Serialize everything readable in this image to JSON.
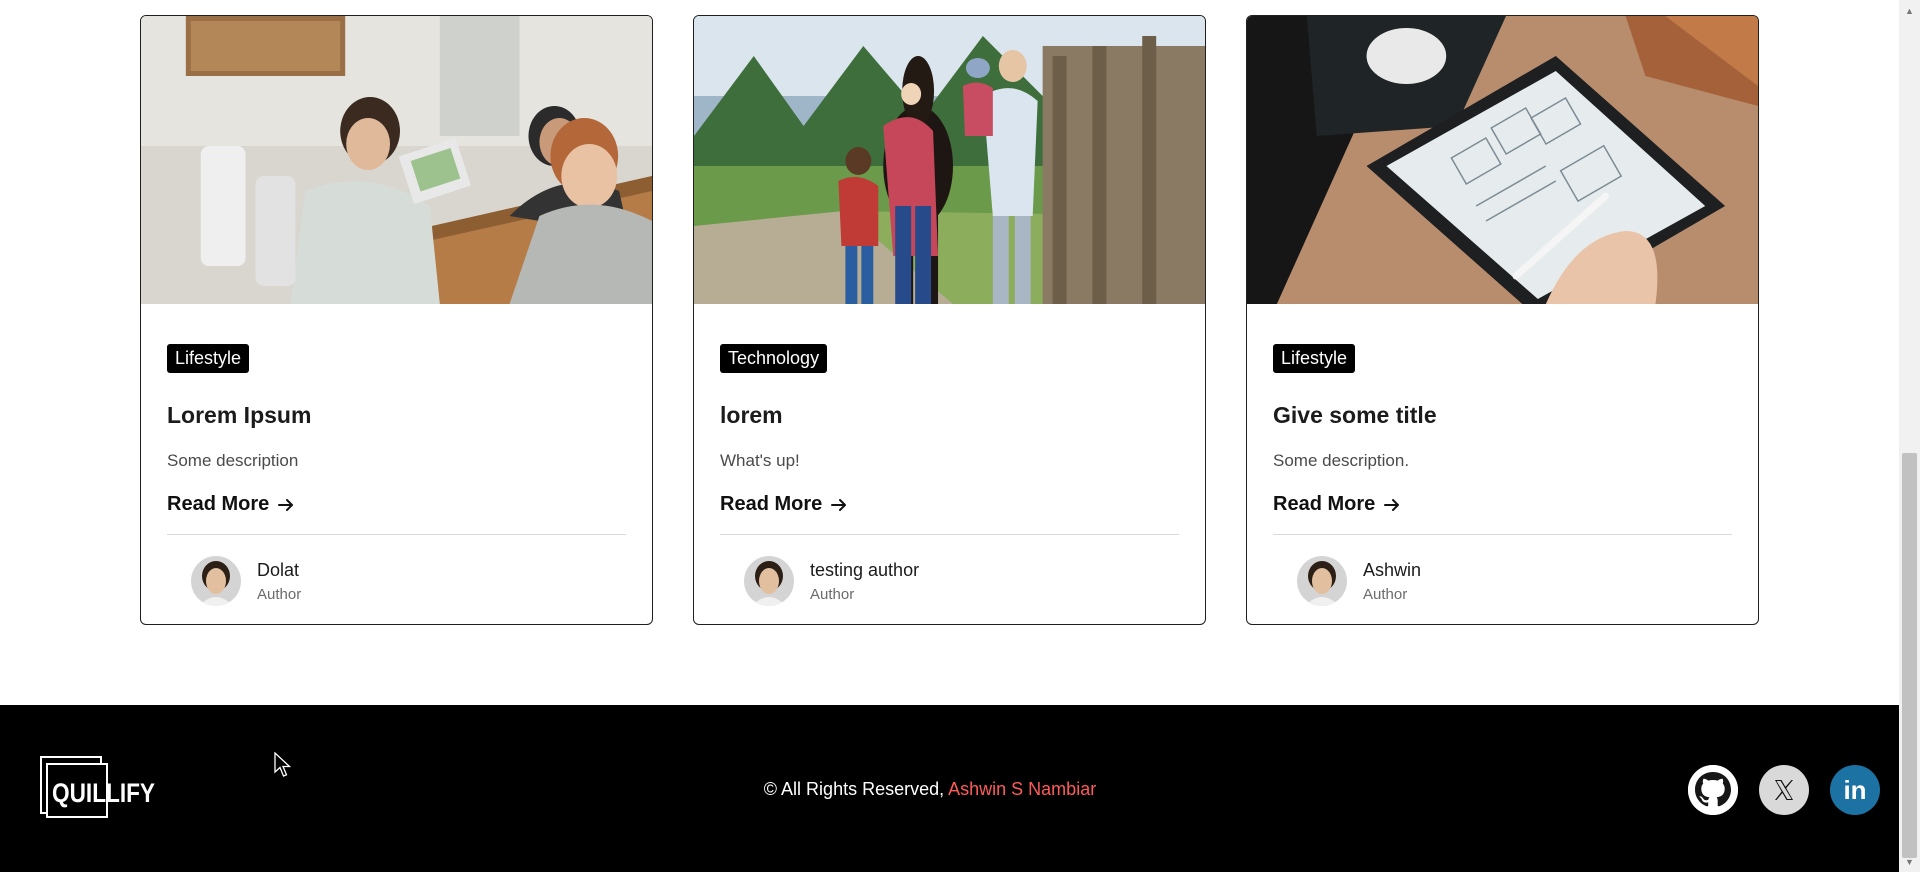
{
  "cards": [
    {
      "category": "Lifestyle",
      "title": "Lorem Ipsum",
      "description": "Some description",
      "read_more": "Read More",
      "author_name": "Dolat",
      "author_role": "Author"
    },
    {
      "category": "Technology",
      "title": "lorem",
      "description": "What's up!",
      "read_more": "Read More",
      "author_name": "testing author",
      "author_role": "Author"
    },
    {
      "category": "Lifestyle",
      "title": "Give some title",
      "description": "Some description.",
      "read_more": "Read More",
      "author_name": "Ashwin",
      "author_role": "Author"
    }
  ],
  "footer": {
    "logo_text": "QUILLIFY",
    "copyright_prefix": "© All Rights Reserved,",
    "owner": "Ashwin S Nambiar",
    "socials": [
      "github-icon",
      "x-icon",
      "linkedin-icon"
    ],
    "linkedin_text": "in"
  },
  "colors": {
    "footer_bg": "#000000",
    "owner_accent": "#ff5a5a",
    "linkedin_bg": "#1c72a3",
    "badge_bg": "#000000"
  }
}
